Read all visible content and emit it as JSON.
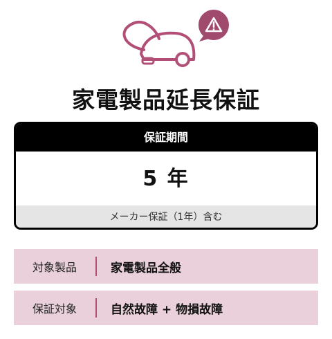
{
  "icons": {
    "hero": "vacuum-cleaner-icon",
    "badge": "warning-icon",
    "accent_color": "#b14f76",
    "badge_color": "#a04a6e"
  },
  "title": "家電製品延長保証",
  "card": {
    "header": "保証期間",
    "value": "5 年",
    "note": "メーカー保証（1年）含む"
  },
  "rows": [
    {
      "label": "対象製品",
      "value": "家電製品全般"
    },
    {
      "label": "保証対象",
      "value": "自然故障 + 物損故障"
    }
  ]
}
